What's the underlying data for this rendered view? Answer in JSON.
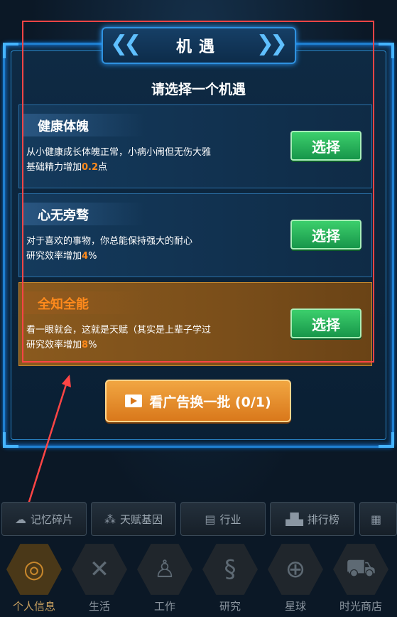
{
  "dialog": {
    "title": "机遇",
    "subtitle": "请选择一个机遇"
  },
  "cards": [
    {
      "name": "健康体魄",
      "desc_line1": "从小健康成长体魄正常，小病小闹但无伤大雅",
      "desc_line2_prefix": "基础精力增加",
      "desc_line2_value": "0.2",
      "desc_line2_suffix": "点",
      "button": "选择"
    },
    {
      "name": "心无旁骛",
      "desc_line1": "对于喜欢的事物，你总能保持强大的耐心",
      "desc_line2_prefix": "研究效率增加",
      "desc_line2_value": "4",
      "desc_line2_suffix": "%",
      "button": "选择"
    },
    {
      "name": "全知全能",
      "desc_line1": "看一眼就会，这就是天赋（其实是上辈子学过",
      "desc_line2_prefix": "研究效率增加",
      "desc_line2_value": "8",
      "desc_line2_suffix": "%",
      "button": "选择"
    }
  ],
  "ad_button": "看广告换一批 (0/1)",
  "subtabs": [
    {
      "icon": "brain-icon",
      "label": "记忆碎片"
    },
    {
      "icon": "gene-icon",
      "label": "天赋基因"
    },
    {
      "icon": "document-icon",
      "label": "行业"
    },
    {
      "icon": "podium-icon",
      "label": "排行榜"
    },
    {
      "icon": "building-icon",
      "label": ""
    }
  ],
  "nav": [
    {
      "icon": "fingerprint-icon",
      "label": "个人信息"
    },
    {
      "icon": "fork-knife-icon",
      "label": "生活"
    },
    {
      "icon": "worker-desk-icon",
      "label": "工作"
    },
    {
      "icon": "dna-icon",
      "label": "研究"
    },
    {
      "icon": "globe-icon",
      "label": "星球"
    },
    {
      "icon": "shop-cart-icon",
      "label": "时光商店"
    }
  ],
  "colors": {
    "frame": "#1f7fd0",
    "highlight": "#ff8a1c",
    "select_green": "#17964a",
    "annotation_red": "#ff4545"
  }
}
